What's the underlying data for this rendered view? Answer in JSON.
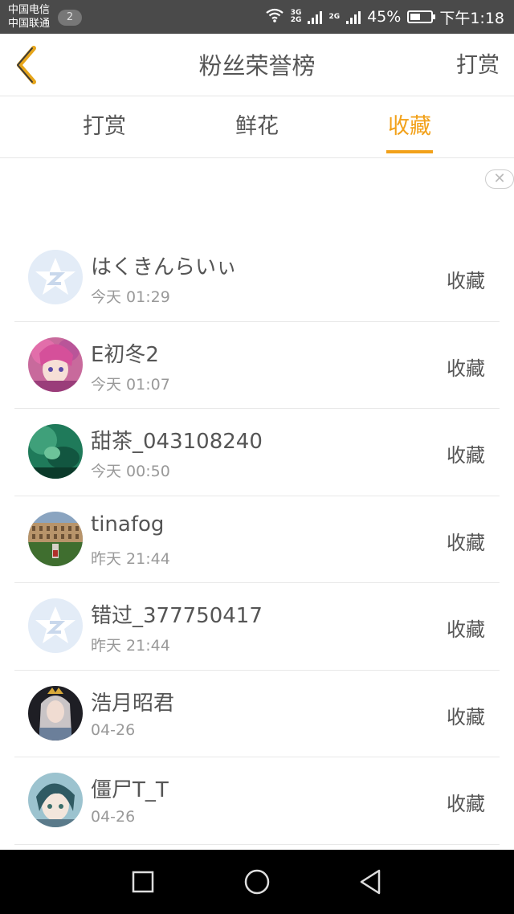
{
  "status_bar": {
    "carrier_1": "中国电信",
    "carrier_2": "中国联通",
    "notification_count": "2",
    "net_tag_1": "3G\n2G",
    "net_tag_2": "2G",
    "battery_percent": "45%",
    "battery_level": 0.45,
    "time": "下午1:18"
  },
  "header": {
    "title": "粉丝荣誉榜",
    "action_label": "打赏",
    "back_icon": "chevron-left-icon",
    "accent_color": "#f2a11a"
  },
  "tabs": [
    {
      "label": "打赏",
      "active": false
    },
    {
      "label": "鲜花",
      "active": false
    },
    {
      "label": "收藏",
      "active": true
    }
  ],
  "close_glyph": "✕",
  "list": [
    {
      "name": "はくきんらいぃ",
      "time": "今天 01:29",
      "action": "收藏",
      "avatar": "default-qq-avatar"
    },
    {
      "name": "E初冬2",
      "time": "今天 01:07",
      "action": "收藏",
      "avatar": "anime-girl-pink-hair"
    },
    {
      "name": "甜茶_043108240",
      "time": "今天 00:50",
      "action": "收藏",
      "avatar": "green-photo"
    },
    {
      "name": "tinafog",
      "time": "昨天 21:44",
      "action": "收藏",
      "avatar": "building-photo"
    },
    {
      "name": "错过_377750417",
      "time": "昨天 21:44",
      "action": "收藏",
      "avatar": "default-qq-avatar"
    },
    {
      "name": "浩月昭君",
      "time": "04-26",
      "action": "收藏",
      "avatar": "game-character"
    },
    {
      "name": "僵尸T_T",
      "time": "04-26",
      "action": "收藏",
      "avatar": "anime-boy"
    }
  ]
}
